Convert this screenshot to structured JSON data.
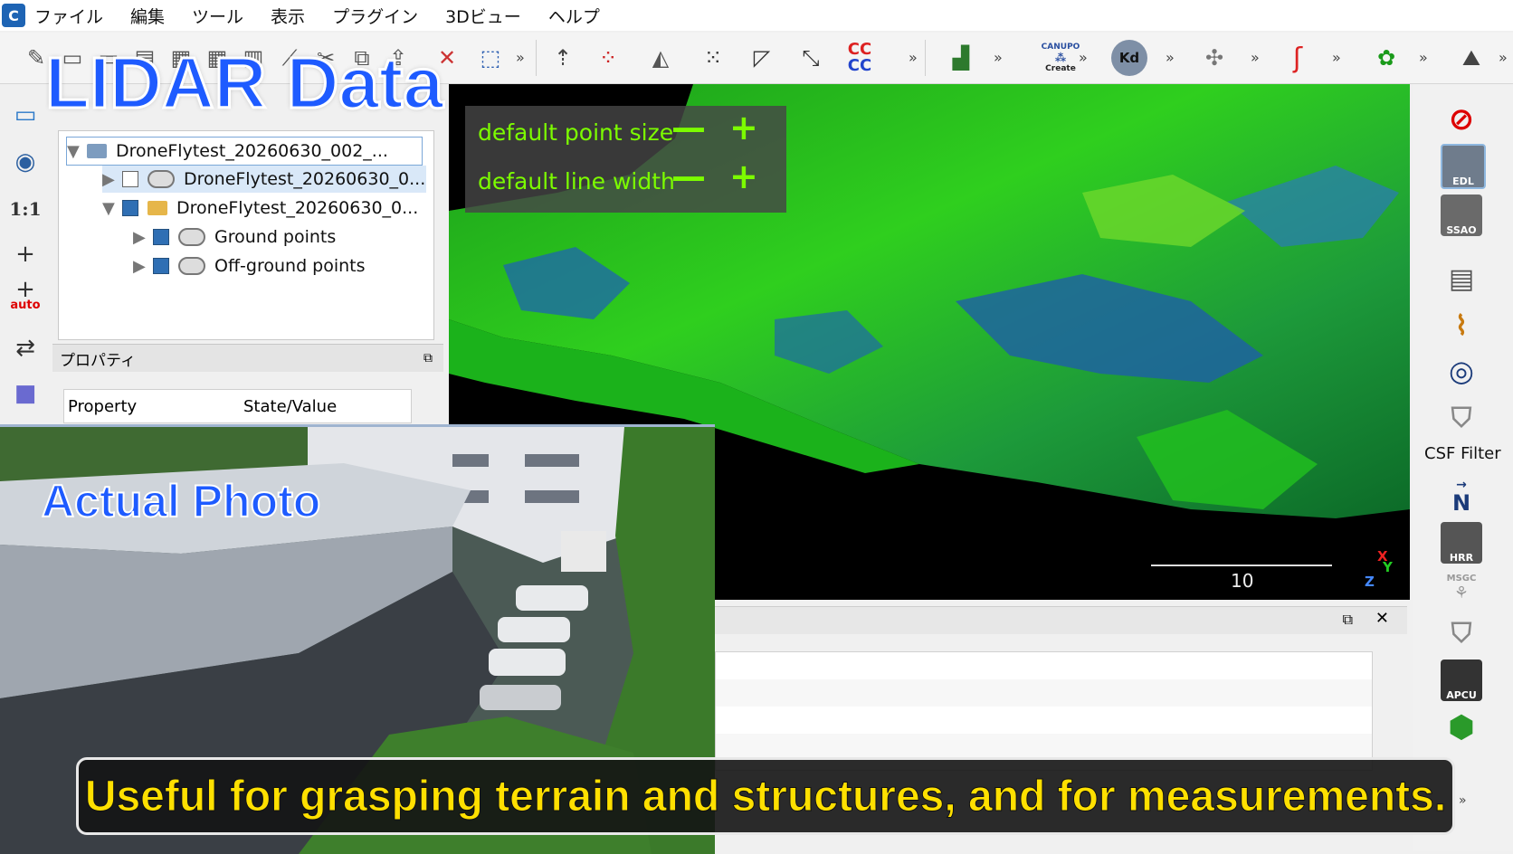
{
  "app": {
    "menu": [
      "ファイル",
      "編集",
      "ツール",
      "表示",
      "プラグイン",
      "3Dビュー",
      "ヘルプ"
    ]
  },
  "toolbar": {
    "plugin_labels": {
      "canupo": "CANUPO",
      "canupo_create": "Create",
      "kd": "Kd",
      "cc": "CC"
    }
  },
  "left_tools": {
    "one_to_one": "1:1",
    "auto": "auto"
  },
  "db_tree": {
    "root": "DroneFlytest_20260630_002_...",
    "children": [
      {
        "label": "DroneFlytest_20260630_0...",
        "checked": false
      },
      {
        "label": "DroneFlytest_20260630_0...",
        "checked": true
      }
    ],
    "grandchildren": [
      {
        "label": "Ground points",
        "checked": true
      },
      {
        "label": "Off-ground points",
        "checked": true
      }
    ]
  },
  "properties": {
    "title": "プロパティ",
    "col_property": "Property",
    "col_value": "State/Value"
  },
  "viewer": {
    "point_size_label": "default point size",
    "line_width_label": "default line width",
    "minus": "—",
    "plus": "+",
    "scale_value": "10",
    "axes": {
      "x": "X",
      "y": "Y",
      "z": "Z"
    }
  },
  "right_tools": {
    "edl": "EDL",
    "ssao": "SSAO",
    "csf_filter": "CSF Filter",
    "north": "N",
    "hrr": "HRR",
    "msgc": "MSGC",
    "apcu": "APCU"
  },
  "overlay": {
    "lidar_title": "LIDAR Data",
    "photo_title": "Actual Photo",
    "caption": "Useful for grasping terrain and structures, and for measurements."
  },
  "colors": {
    "accent_green": "#7cfc00",
    "title_blue": "#1e5bff",
    "caption_yellow": "#ffe000"
  }
}
